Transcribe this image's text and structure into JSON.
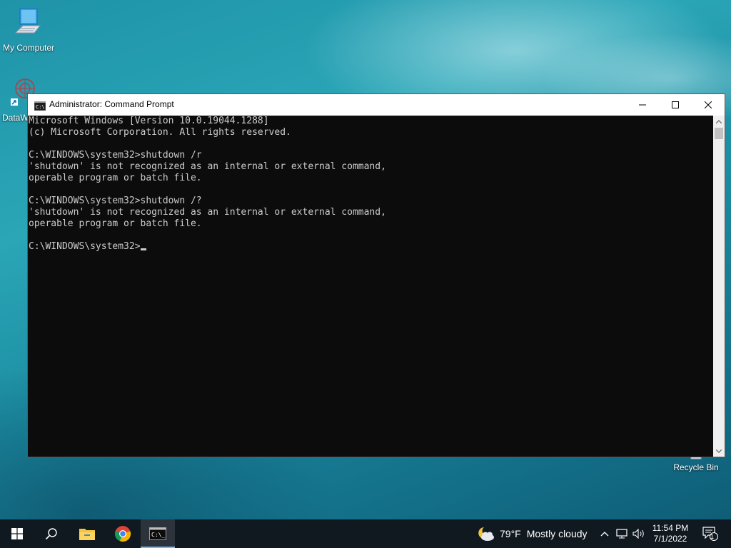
{
  "desktop": {
    "icons": [
      {
        "label": "My Computer"
      },
      {
        "label": "DataW"
      },
      {
        "label": "Recycle Bin"
      }
    ]
  },
  "window": {
    "title": "Administrator: Command Prompt",
    "console_lines": [
      "Microsoft Windows [Version 10.0.19044.1288]",
      "(c) Microsoft Corporation. All rights reserved.",
      "",
      "C:\\WINDOWS\\system32>shutdown /r",
      "'shutdown' is not recognized as an internal or external command,",
      "operable program or batch file.",
      "",
      "C:\\WINDOWS\\system32>shutdown /?",
      "'shutdown' is not recognized as an internal or external command,",
      "operable program or batch file.",
      "",
      "C:\\WINDOWS\\system32>"
    ],
    "background_color": "#0c0c0c",
    "text_color": "#cccccc"
  },
  "taskbar": {
    "weather": {
      "temp": "79°F",
      "condition": "Mostly cloudy"
    },
    "clock": {
      "time": "11:54 PM",
      "date": "7/1/2022"
    },
    "notification_count": "1",
    "accent": "#76b9ed"
  }
}
